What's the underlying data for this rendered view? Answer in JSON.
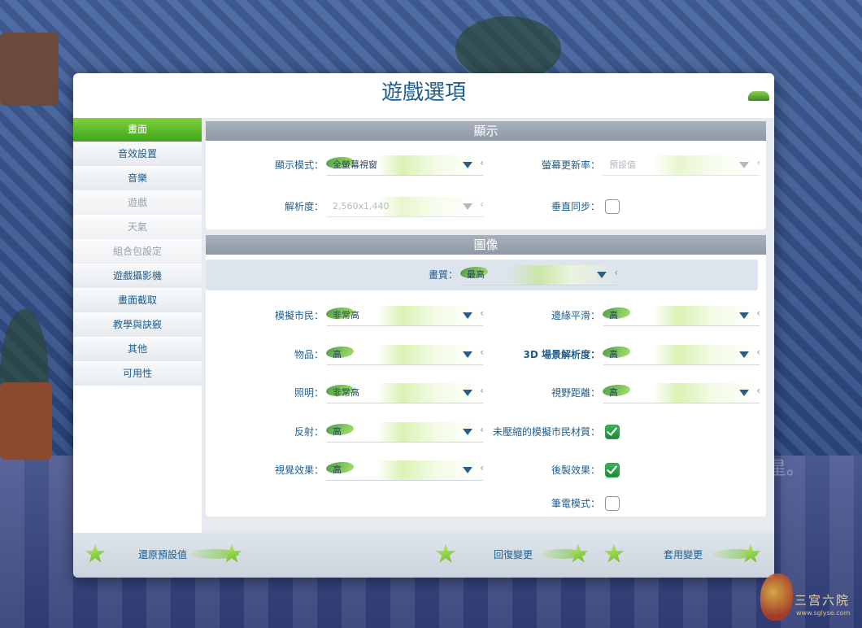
{
  "dialog": {
    "title": "遊戲選項"
  },
  "sidebar": {
    "items": [
      {
        "label": "畫面",
        "state": "active"
      },
      {
        "label": "音效設置",
        "state": "normal"
      },
      {
        "label": "音樂",
        "state": "normal"
      },
      {
        "label": "遊戲",
        "state": "dim"
      },
      {
        "label": "天氣",
        "state": "dim"
      },
      {
        "label": "組合包設定",
        "state": "dim"
      },
      {
        "label": "遊戲攝影機",
        "state": "normal"
      },
      {
        "label": "畫面截取",
        "state": "normal"
      },
      {
        "label": "教學與訣竅",
        "state": "normal"
      },
      {
        "label": "其他",
        "state": "normal"
      },
      {
        "label": "可用性",
        "state": "normal"
      }
    ]
  },
  "display": {
    "header": "顯示",
    "display_mode": {
      "label": "顯示模式：",
      "value": "全螢幕視窗"
    },
    "refresh_rate": {
      "label": "螢幕更新率：",
      "value": "預設值"
    },
    "resolution": {
      "label": "解析度：",
      "value": "2,560x1,440"
    },
    "vsync": {
      "label": "垂直同步：",
      "checked": false
    }
  },
  "graphics": {
    "header": "圖像",
    "quality": {
      "label": "畫質：",
      "value": "最高"
    },
    "sims": {
      "label": "模擬市民：",
      "value": "非常高"
    },
    "edge_smoothing": {
      "label": "邊緣平滑：",
      "value": "高"
    },
    "objects": {
      "label": "物品：",
      "value": "高"
    },
    "scene_resolution": {
      "label": "3D 場景解析度：",
      "value": "高"
    },
    "lighting": {
      "label": "照明：",
      "value": "非常高"
    },
    "view_distance": {
      "label": "視野距離：",
      "value": "高"
    },
    "reflections": {
      "label": "反射：",
      "value": "高"
    },
    "uncompressed_textures": {
      "label": "未壓縮的模擬市民材質：",
      "checked": true
    },
    "visual_effects": {
      "label": "視覺效果：",
      "value": "高"
    },
    "post_processing": {
      "label": "後製效果：",
      "checked": true
    },
    "laptop_mode": {
      "label": "筆電模式：",
      "checked": false
    }
  },
  "footer": {
    "restore_defaults": "還原預設值",
    "revert_changes": "回復變更",
    "apply_changes": "套用變更"
  },
  "background": {
    "partial_text": "星。"
  },
  "watermark": {
    "text": "三宫六院",
    "url": "www.sglyse.com"
  }
}
